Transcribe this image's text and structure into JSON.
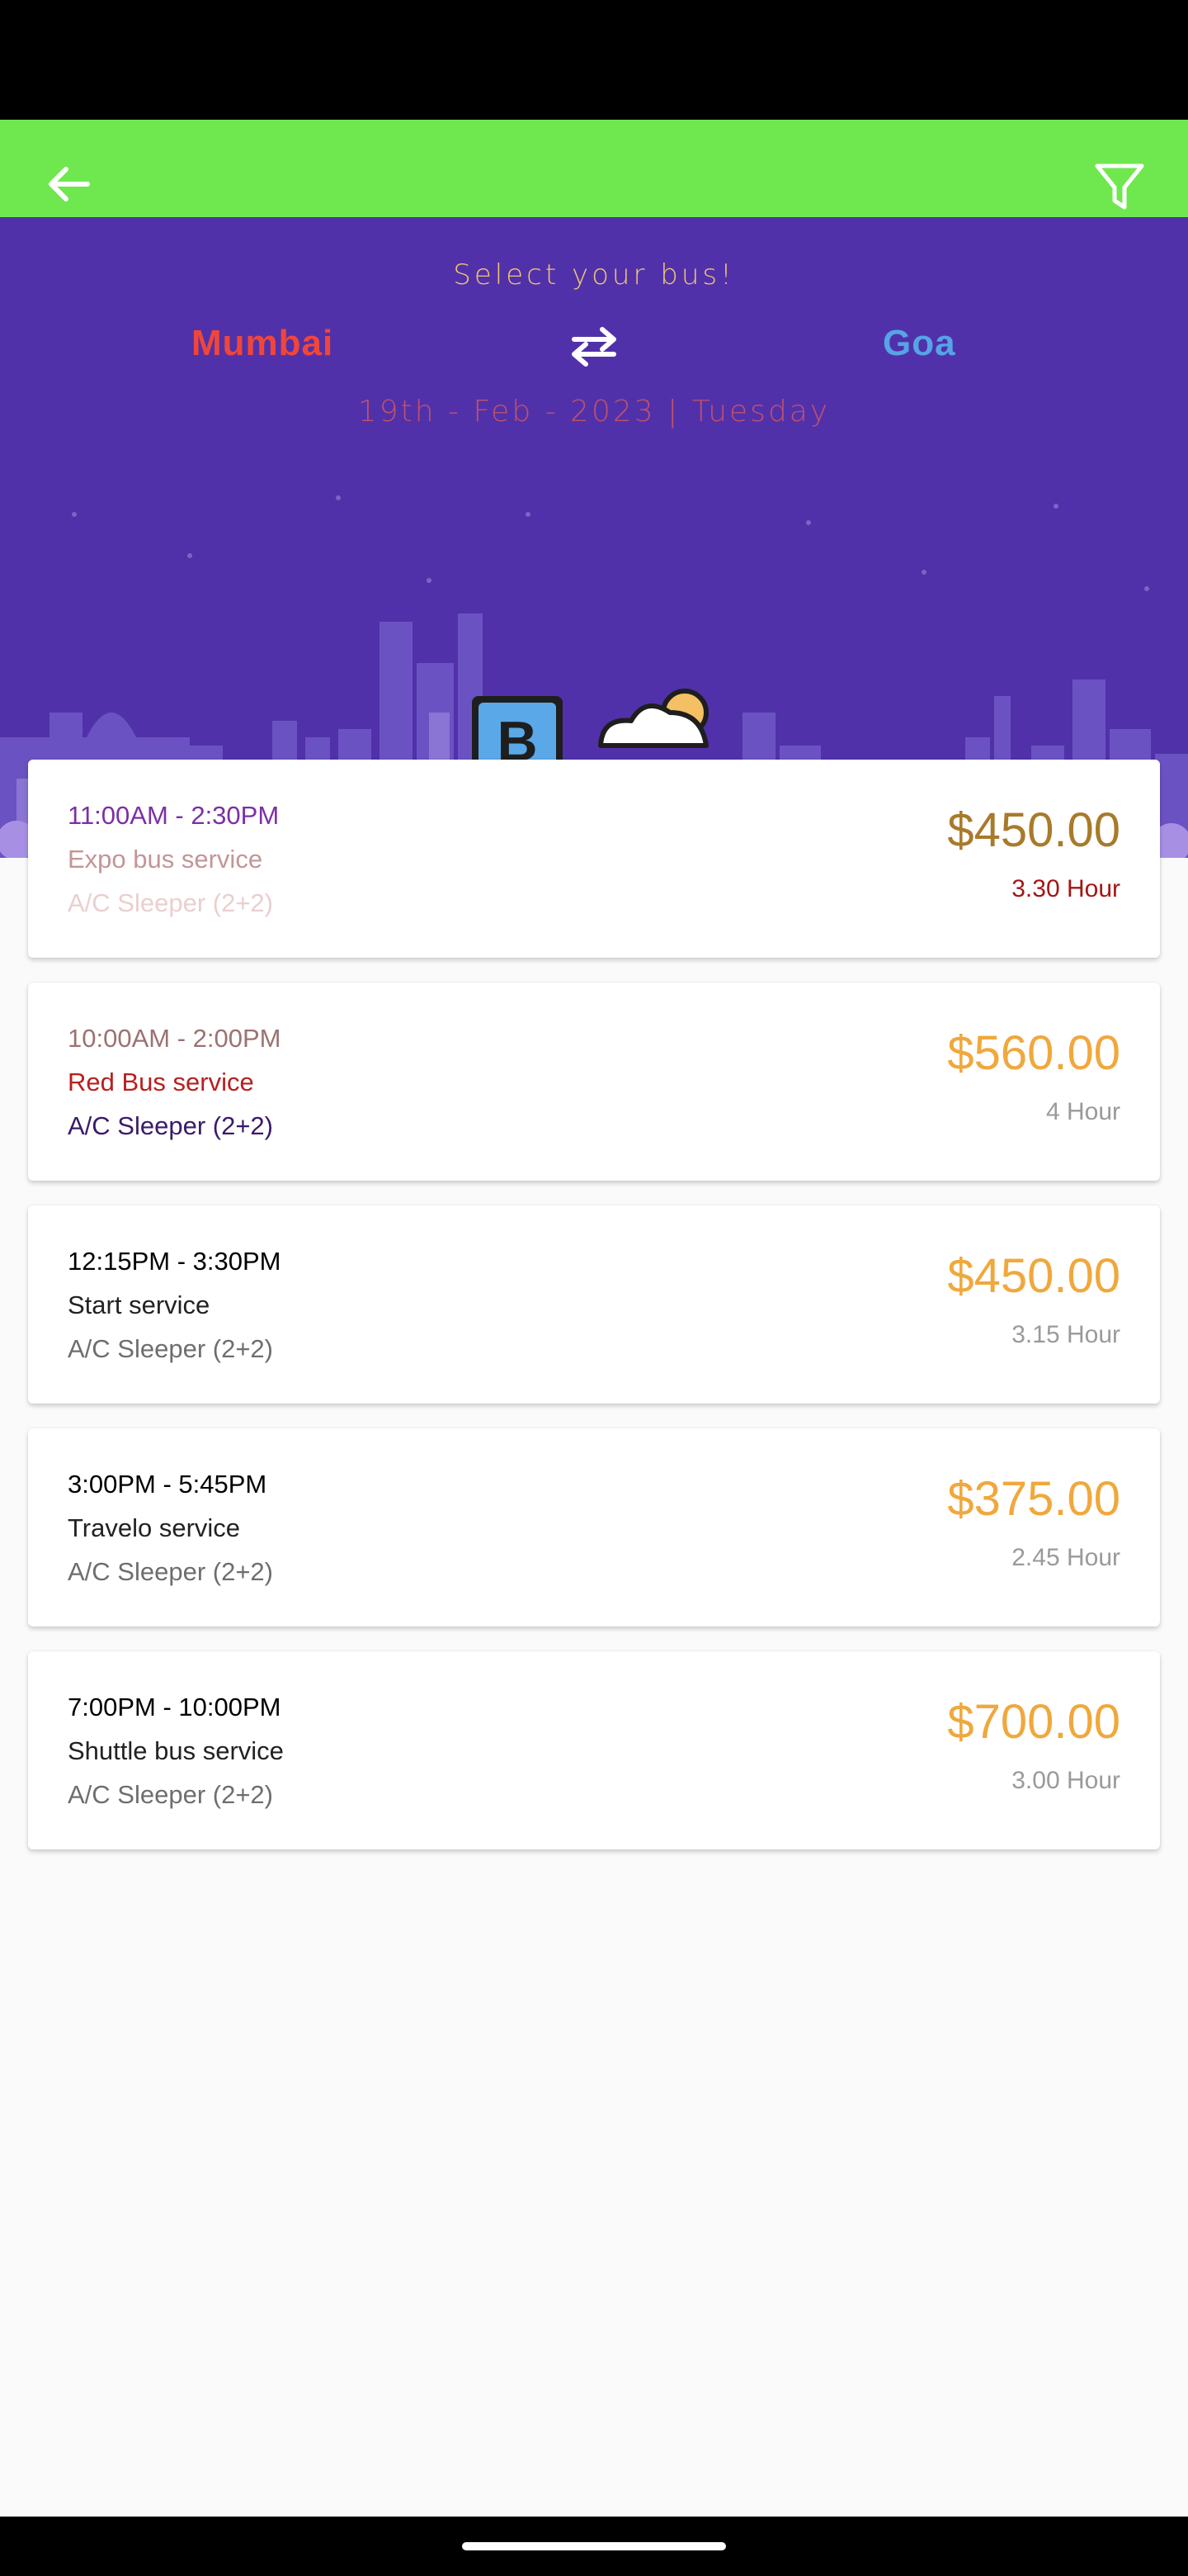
{
  "header": {
    "subtitle": "Select your bus!",
    "from": "Mumbai",
    "to": "Goa",
    "date": "19th - Feb - 2023 | Tuesday"
  },
  "colors": {
    "top_bar": "#6ee84e",
    "hero": "#5131aa",
    "price": "#f0a83c"
  },
  "icons": [
    "back-arrow-icon",
    "filter-icon",
    "swap-icon",
    "bus-stop-illustration"
  ],
  "buses": [
    {
      "time": "11:00AM - 2:30PM",
      "operator": "Expo bus service",
      "type": "A/C Sleeper (2+2)",
      "price": "$450.00",
      "duration": "3.30 Hour",
      "colors": {
        "time": "#7b2fa8",
        "operator": "#c39598",
        "type": "#eacfcf",
        "price": "#a87a2a",
        "duration": "#a31616"
      }
    },
    {
      "time": "10:00AM - 2:00PM",
      "operator": "Red Bus service",
      "type": "A/C Sleeper (2+2)",
      "price": "$560.00",
      "duration": "4 Hour",
      "colors": {
        "time": "#9c7272",
        "operator": "#b81e1e",
        "type": "#3a1a6a",
        "price": "#f0a83c",
        "duration": "#9a9a9a"
      }
    },
    {
      "time": "12:15PM - 3:30PM",
      "operator": "Start service",
      "type": "A/C Sleeper (2+2)",
      "price": "$450.00",
      "duration": "3.15 Hour",
      "colors": {
        "time": "#000000",
        "operator": "#222222",
        "type": "#6e6e6e",
        "price": "#f0a83c",
        "duration": "#9a9a9a"
      }
    },
    {
      "time": "3:00PM - 5:45PM",
      "operator": "Travelo service",
      "type": "A/C Sleeper (2+2)",
      "price": "$375.00",
      "duration": "2.45 Hour",
      "colors": {
        "time": "#000000",
        "operator": "#222222",
        "type": "#6e6e6e",
        "price": "#f0a83c",
        "duration": "#9a9a9a"
      }
    },
    {
      "time": "7:00PM - 10:00PM",
      "operator": "Shuttle bus service",
      "type": "A/C Sleeper (2+2)",
      "price": "$700.00",
      "duration": "3.00 Hour",
      "colors": {
        "time": "#000000",
        "operator": "#222222",
        "type": "#6e6e6e",
        "price": "#f0a83c",
        "duration": "#9a9a9a"
      }
    }
  ]
}
